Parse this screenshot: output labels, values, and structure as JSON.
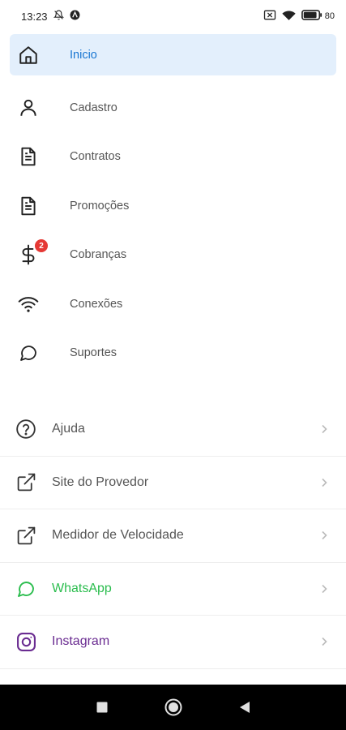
{
  "status_bar": {
    "time": "13:23",
    "battery_percent": "80"
  },
  "primary_menu": [
    {
      "label": "Inicio",
      "icon": "home-icon",
      "active": true
    },
    {
      "label": "Cadastro",
      "icon": "person-icon"
    },
    {
      "label": "Contratos",
      "icon": "document-icon"
    },
    {
      "label": "Promoções",
      "icon": "document-icon"
    },
    {
      "label": "Cobranças",
      "icon": "dollar-icon",
      "badge": "2"
    },
    {
      "label": "Conexões",
      "icon": "wifi-icon"
    },
    {
      "label": "Suportes",
      "icon": "chat-bubble-icon"
    }
  ],
  "secondary_menu": [
    {
      "label": "Ajuda",
      "icon": "help-circle-icon"
    },
    {
      "label": "Site do Provedor",
      "icon": "external-link-icon"
    },
    {
      "label": "Medidor de Velocidade",
      "icon": "external-link-icon"
    },
    {
      "label": "WhatsApp",
      "icon": "whatsapp-icon"
    },
    {
      "label": "Instagram",
      "icon": "instagram-icon"
    }
  ],
  "colors": {
    "active_bg": "#e3effc",
    "active_text": "#1976d2",
    "badge": "#e53935",
    "whatsapp": "#2bbd4e",
    "instagram": "#6a2c91"
  }
}
